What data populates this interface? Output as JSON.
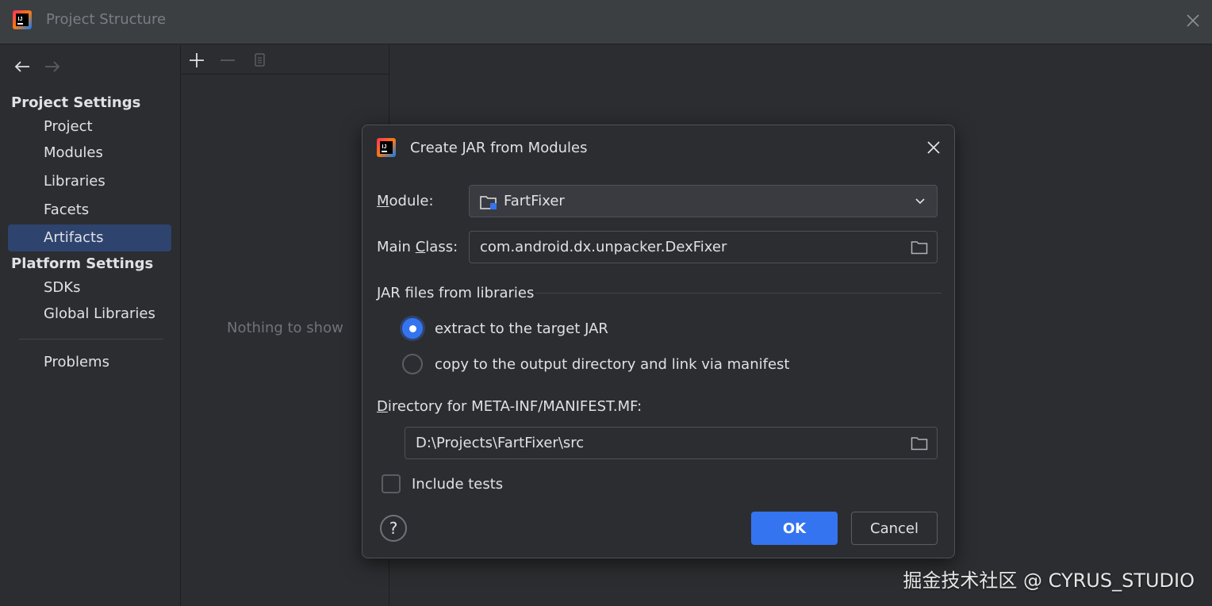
{
  "window": {
    "title": "Project Structure",
    "logo_text": "IJ",
    "icons": {
      "logo": "intellij-logo-icon",
      "close": "close-icon"
    }
  },
  "navigation": {
    "back": "arrow-left-icon",
    "forward": "arrow-right-icon"
  },
  "sidebar": {
    "sections": [
      {
        "header": "Project Settings",
        "items": [
          {
            "label": "Project",
            "selected": false
          },
          {
            "label": "Modules",
            "selected": false
          },
          {
            "label": "Libraries",
            "selected": false
          },
          {
            "label": "Facets",
            "selected": false
          },
          {
            "label": "Artifacts",
            "selected": true
          }
        ]
      },
      {
        "header": "Platform Settings",
        "items": [
          {
            "label": "SDKs",
            "selected": false
          },
          {
            "label": "Global Libraries",
            "selected": false
          }
        ]
      }
    ],
    "problems_label": "Problems"
  },
  "middle_panel": {
    "toolbar": {
      "add": "plus-icon",
      "remove": "minus-icon",
      "copy": "copy-icon"
    },
    "empty_text": "Nothing to show"
  },
  "dialog": {
    "title": "Create JAR from Modules",
    "logo_text": "IJ",
    "module": {
      "label_mnemonic": "M",
      "label_rest": "odule:",
      "value": "FartFixer",
      "icon": "module-folder-icon"
    },
    "main_class": {
      "label_pre": "Main ",
      "label_mnemonic": "C",
      "label_post": "lass:",
      "value": "com.android.dx.unpacker.DexFixer"
    },
    "jar_group": {
      "title": "JAR files from libraries",
      "options": [
        {
          "label": "extract to the target JAR",
          "checked": true
        },
        {
          "label": "copy to the output directory and link via manifest",
          "checked": false
        }
      ]
    },
    "manifest_dir": {
      "label_mnemonic": "D",
      "label_rest": "irectory for META-INF/MANIFEST.MF:",
      "value": "D:\\Projects\\FartFixer\\src"
    },
    "include_tests": {
      "label": "Include tests",
      "checked": false
    },
    "help": "?",
    "ok_label": "OK",
    "cancel_label": "Cancel"
  },
  "watermark": "掘金技术社区 @ CYRUS_STUDIO",
  "colors": {
    "background": "#2b2d30",
    "titlebar": "#3c3f41",
    "accent": "#3574f0",
    "selection": "#2e436e",
    "border": "#4e5157",
    "text": "#dfe1e5",
    "muted_text": "#6f737a"
  }
}
